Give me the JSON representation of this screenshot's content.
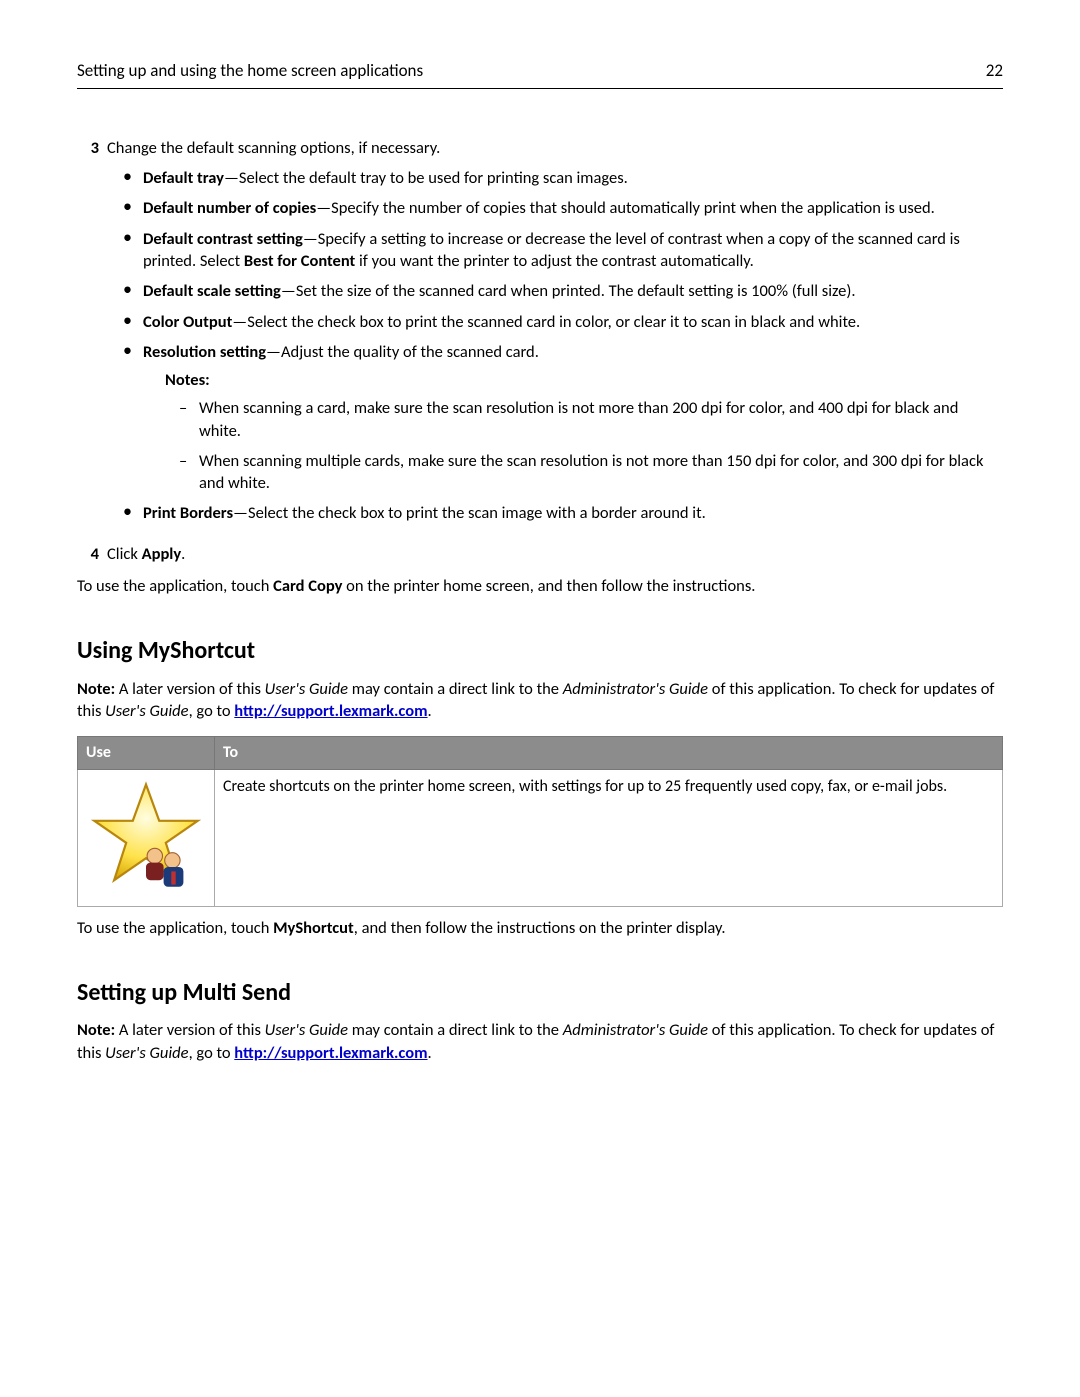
{
  "header": {
    "title": "Setting up and using the home screen applications",
    "page": "22"
  },
  "step3": {
    "number": "3",
    "intro": "Change the default scanning options, if necessary.",
    "bullets": [
      {
        "term": "Default tray",
        "text": "—Select the default tray to be used for printing scan images."
      },
      {
        "term": "Default number of copies",
        "text": "—Specify the number of copies that should automatically print when the application is used."
      },
      {
        "term": "Default contrast setting",
        "text_a": "—Specify a setting to increase or decrease the level of contrast when a copy of the scanned card is printed. Select ",
        "bold": "Best for Content",
        "text_b": " if you want the printer to adjust the contrast automatically."
      },
      {
        "term": "Default scale setting",
        "text": "—Set the size of the scanned card when printed. The default setting is 100% (full size)."
      },
      {
        "term": "Color Output",
        "text": "—Select the check box to print the scanned card in color, or clear it to scan in black and white."
      },
      {
        "term": "Resolution setting",
        "text": "—Adjust the quality of the scanned card."
      }
    ],
    "notes_label": "Notes:",
    "notes": [
      "When scanning a card, make sure the scan resolution is not more than 200 dpi for color, and 400 dpi for black and white.",
      "When scanning multiple cards, make sure the scan resolution is not more than 150 dpi for color, and 300 dpi for black and white."
    ],
    "bullet_last": {
      "term": "Print Borders",
      "text": "—Select the check box to print the scan image with a border around it."
    }
  },
  "step4": {
    "number": "4",
    "prefix": "Click ",
    "bold": "Apply",
    "suffix": "."
  },
  "cardcopy": {
    "prefix": "To use the application, touch ",
    "bold": "Card Copy",
    "suffix": " on the printer home screen, and then follow the instructions."
  },
  "myshortcut": {
    "heading": "Using MyShortcut",
    "note_bold": "Note:",
    "note_a": " A later version of this ",
    "note_i1": "User's Guide",
    "note_b": " may contain a direct link to the ",
    "note_i2": "Administrator's Guide",
    "note_c": " of this application. To check for updates of this ",
    "note_i3": "User's Guide",
    "note_d": ", go to ",
    "link": "http://support.lexmark.com",
    "period": ".",
    "th_use": "Use",
    "th_to": "To",
    "row_text": "Create shortcuts on the printer home screen, with settings for up to 25 frequently used copy, fax, or e-mail jobs.",
    "after_prefix": "To use the application, touch ",
    "after_bold": "MyShortcut",
    "after_suffix": ", and then follow the instructions on the printer display."
  },
  "multisend": {
    "heading": "Setting up Multi Send",
    "note_bold": "Note:",
    "note_a": " A later version of this ",
    "note_i1": "User's Guide",
    "note_b": " may contain a direct link to the ",
    "note_i2": "Administrator's Guide",
    "note_c": " of this application. To check for updates of this ",
    "note_i3": "User's Guide",
    "note_d": ", go to ",
    "link": "http://support.lexmark.com",
    "period": "."
  }
}
